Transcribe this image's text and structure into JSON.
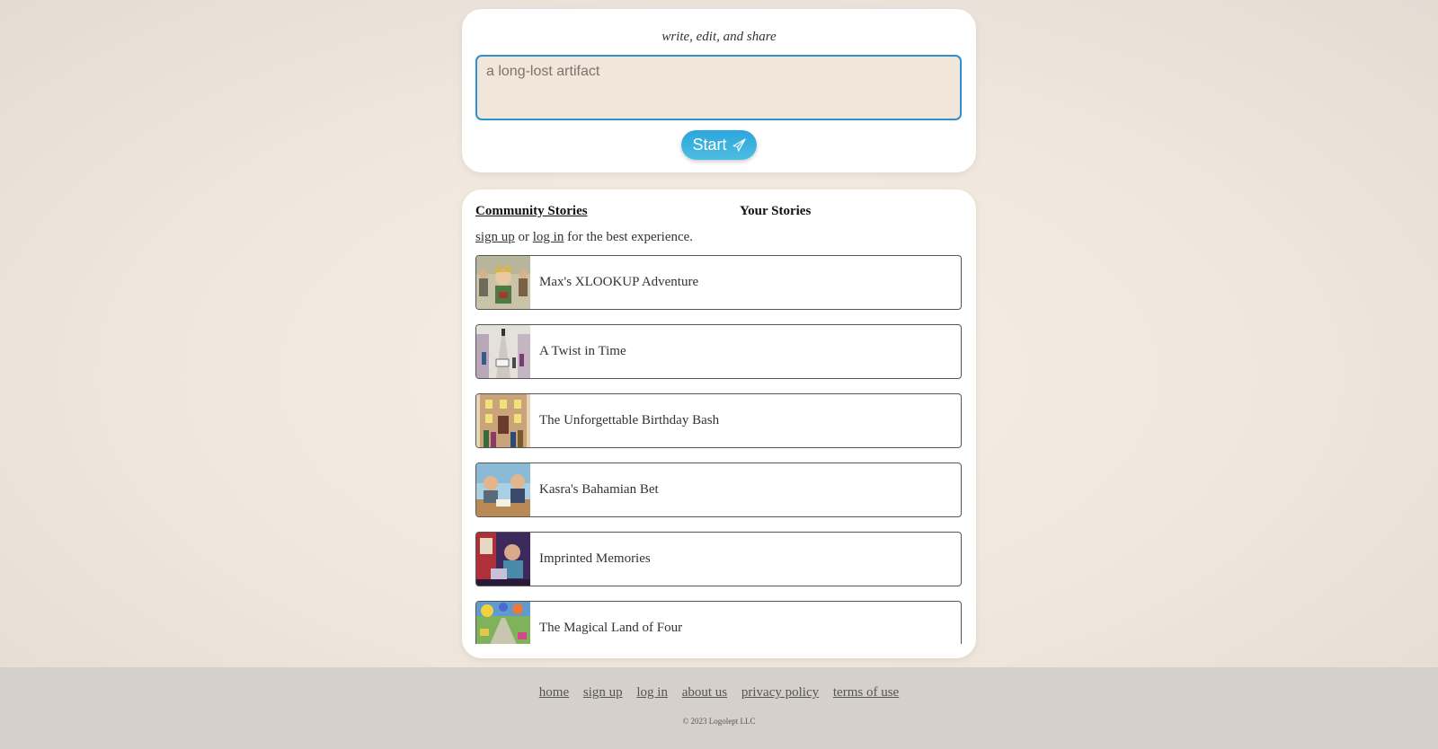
{
  "compose": {
    "tagline": "write, edit, and share",
    "prompt_placeholder": "a long-lost artifact",
    "start_label": "Start"
  },
  "stories_panel": {
    "tabs": {
      "community": "Community Stories",
      "yours": "Your Stories"
    },
    "auth": {
      "sign_up": "sign up",
      "or": "or",
      "log_in": "log in",
      "suffix": "for the best experience."
    },
    "stories": [
      {
        "title": "Max's XLOOKUP Adventure"
      },
      {
        "title": "A Twist in Time"
      },
      {
        "title": "The Unforgettable Birthday Bash"
      },
      {
        "title": "Kasra's Bahamian Bet"
      },
      {
        "title": "Imprinted Memories"
      },
      {
        "title": "The Magical Land of Four"
      }
    ]
  },
  "footer": {
    "links": {
      "home": "home",
      "sign_up": "sign up",
      "log_in": "log in",
      "about": "about us",
      "privacy": "privacy policy",
      "terms": "terms of use"
    },
    "copyright": "© 2023 Logolept LLC"
  }
}
